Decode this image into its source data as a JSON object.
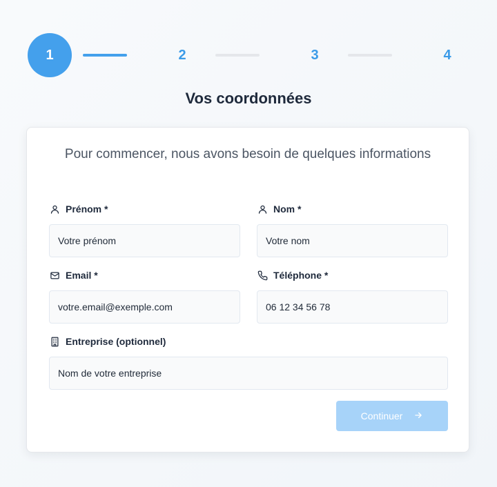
{
  "stepper": {
    "steps": [
      {
        "number": "1",
        "state": "active"
      },
      {
        "number": "2",
        "state": "upcoming"
      },
      {
        "number": "3",
        "state": "upcoming"
      },
      {
        "number": "4",
        "state": "upcoming"
      }
    ],
    "active_color": "#44a0ec",
    "inactive_line_color": "#e5e7eb"
  },
  "page": {
    "title": "Vos coordonnées"
  },
  "card": {
    "subtitle": "Pour commencer, nous avons besoin de quelques informations"
  },
  "form": {
    "first_name": {
      "label": "Prénom *",
      "placeholder": "Votre prénom",
      "value": "",
      "icon": "user-icon"
    },
    "last_name": {
      "label": "Nom *",
      "placeholder": "Votre nom",
      "value": "",
      "icon": "user-icon"
    },
    "email": {
      "label": "Email *",
      "placeholder": "votre.email@exemple.com",
      "value": "",
      "icon": "mail-icon"
    },
    "phone": {
      "label": "Téléphone *",
      "placeholder": "06 12 34 56 78",
      "value": "",
      "icon": "phone-icon"
    },
    "company": {
      "label": "Entreprise (optionnel)",
      "placeholder": "Nom de votre entreprise",
      "value": "",
      "icon": "building-icon"
    }
  },
  "actions": {
    "continue_label": "Continuer",
    "continue_icon": "arrow-right-icon",
    "continue_color": "#a7d3f9",
    "continue_disabled": true
  }
}
